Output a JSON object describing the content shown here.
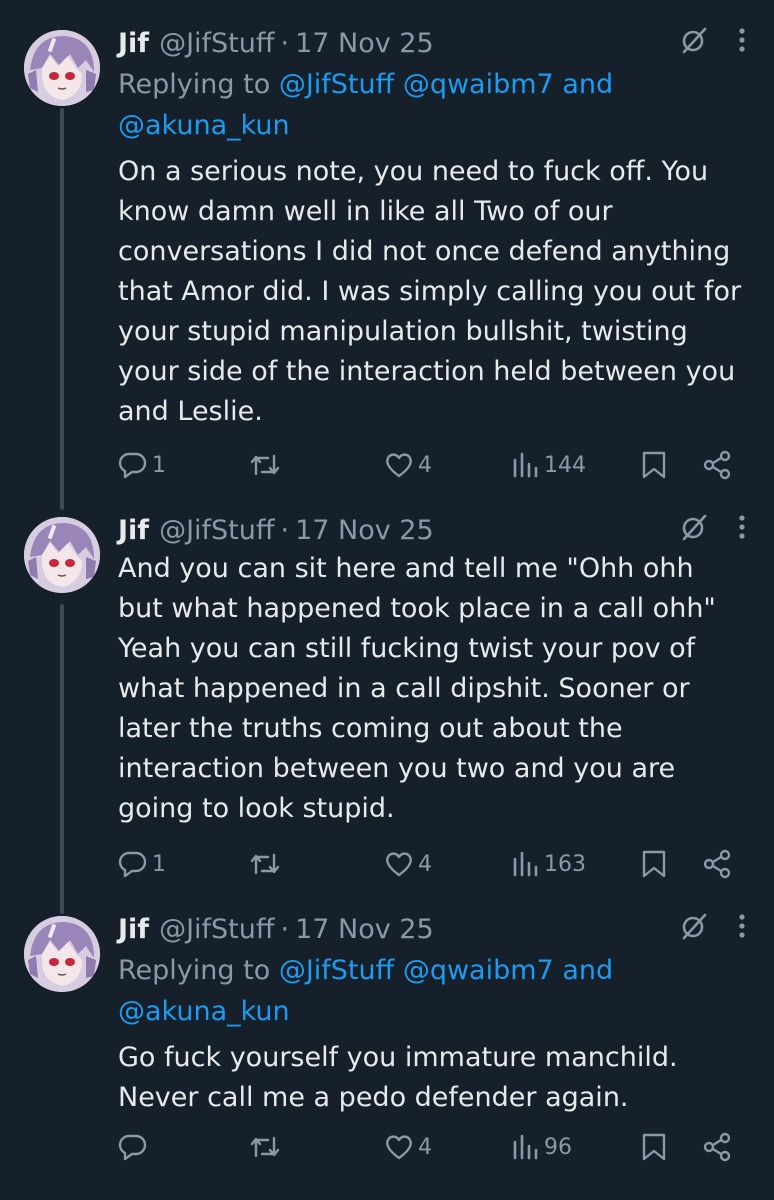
{
  "tweets": [
    {
      "name": "Jif",
      "handle": "@JifStuff",
      "dot": "·",
      "date": "17 Nov 25",
      "reply_prefix": "Replying to",
      "reply_mentions": [
        "@JifStuff",
        "@qwaibm7",
        "and",
        "@akuna_kun"
      ],
      "body": "On a serious note, you need to fuck off. You know damn well in like all Two of our conversations I did not once defend anything that Amor did. I was simply calling you out for your stupid manipulation bullshit, twisting your side of the interaction held between you and Leslie.",
      "replies": "1",
      "retweets": "",
      "likes": "4",
      "views": "144"
    },
    {
      "name": "Jif",
      "handle": "@JifStuff",
      "dot": "·",
      "date": "17 Nov 25",
      "body": "And you can sit here and tell me \"Ohh ohh but what happened took place in a call ohh\" Yeah you can still fucking twist your pov of what happened in a call dipshit. Sooner or later the truths coming out about the interaction between you two and you are going to look stupid.",
      "replies": "1",
      "retweets": "",
      "likes": "4",
      "views": "163"
    },
    {
      "name": "Jif",
      "handle": "@JifStuff",
      "dot": "·",
      "date": "17 Nov 25",
      "reply_prefix": "Replying to",
      "reply_mentions": [
        "@JifStuff",
        "@qwaibm7",
        "and",
        "@akuna_kun"
      ],
      "body": "Go fuck yourself you immature manchild. Never call me a pedo defender again.",
      "replies": "",
      "retweets": "",
      "likes": "4",
      "views": "96"
    }
  ],
  "icons": {
    "reply": "reply-icon",
    "retweet": "retweet-icon",
    "like": "heart-icon",
    "views": "views-icon",
    "bookmark": "bookmark-icon",
    "share": "share-icon",
    "grok": "grok-icon",
    "more": "more-icon"
  },
  "colors": {
    "background": "#15202b",
    "text": "#e7e9ea",
    "muted": "#8b98a5",
    "link": "#1d9bf0"
  }
}
